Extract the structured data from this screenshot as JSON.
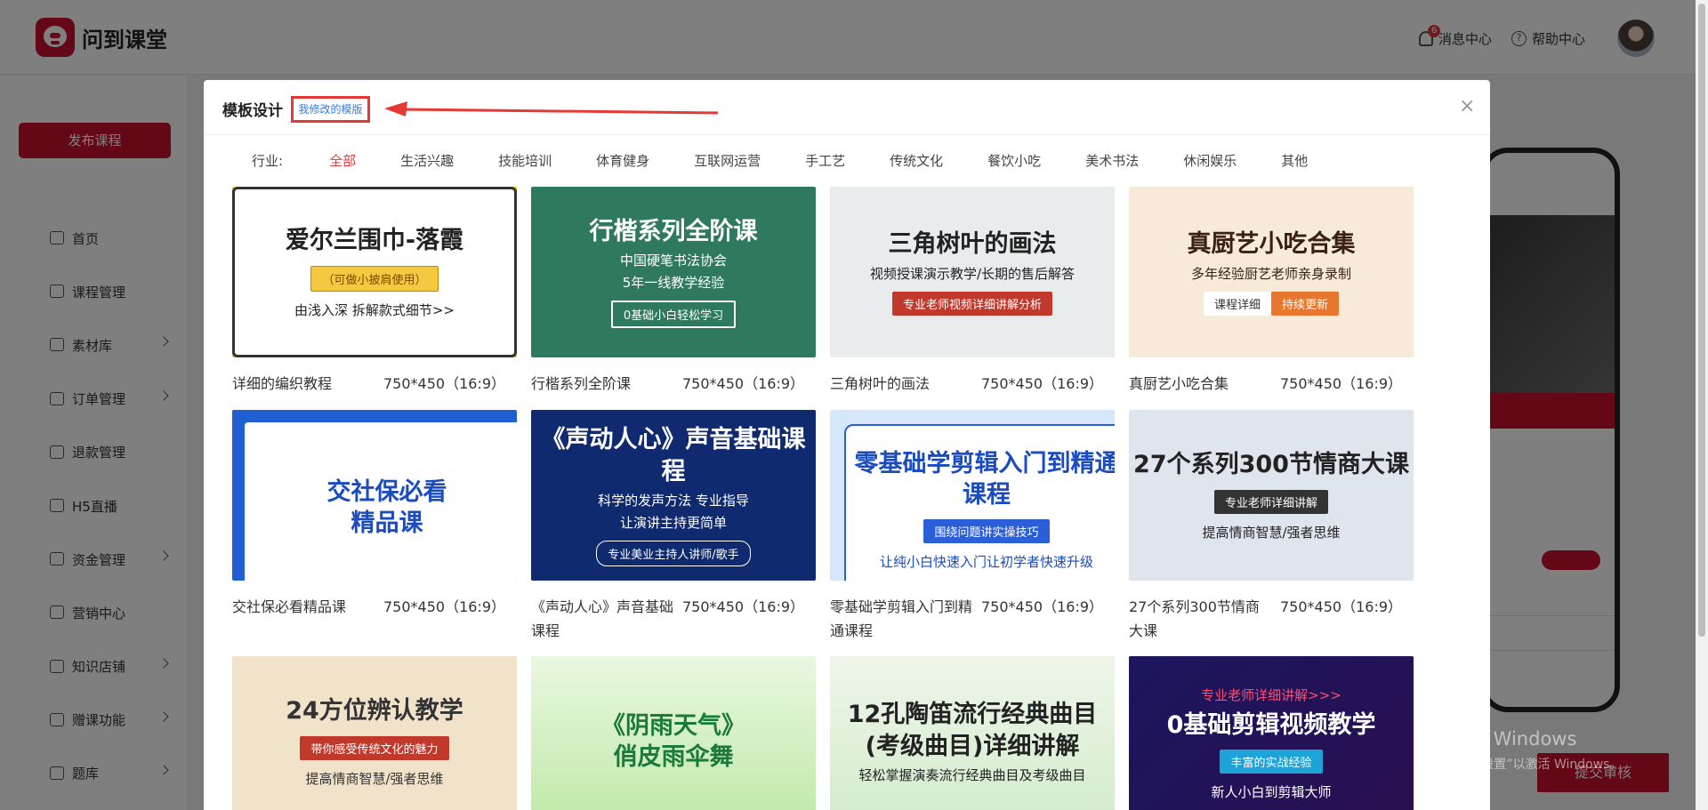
{
  "app": {
    "logo_text": "问到课堂"
  },
  "header": {
    "messages_label": "消息中心",
    "messages_count": "6",
    "help_label": "帮助中心",
    "help_icon_glyph": "?"
  },
  "sidebar": {
    "publish_label": "发布课程",
    "items": [
      {
        "label": "首页",
        "has_arrow": false
      },
      {
        "label": "课程管理",
        "has_arrow": false
      },
      {
        "label": "素材库",
        "has_arrow": true
      },
      {
        "label": "订单管理",
        "has_arrow": true
      },
      {
        "label": "退款管理",
        "has_arrow": false
      },
      {
        "label": "H5直播",
        "has_arrow": false
      },
      {
        "label": "资金管理",
        "has_arrow": true
      },
      {
        "label": "营销中心",
        "has_arrow": false
      },
      {
        "label": "知识店铺",
        "has_arrow": true
      },
      {
        "label": "赠课功能",
        "has_arrow": true
      },
      {
        "label": "题库",
        "has_arrow": true
      }
    ]
  },
  "background": {
    "submit_label": "提交审核"
  },
  "watermark": {
    "line1": "激活 Windows",
    "line2": "转到“设置”以激活 Windows。"
  },
  "modal": {
    "title": "模板设计",
    "my_templates_label": "我修改的模版",
    "close_glyph": "×",
    "filter_label": "行业:",
    "filters": [
      "全部",
      "生活兴趣",
      "技能培训",
      "体育健身",
      "互联网运营",
      "手工艺",
      "传统文化",
      "餐饮小吃",
      "美术书法",
      "休闲娱乐",
      "其他"
    ],
    "active_filter": "全部",
    "templates": [
      {
        "name": "详细的编织教程",
        "size": "750*450（16:9）",
        "thumb_title": "爱尔兰围巾-落霞",
        "thumb_sub": "由浅入深 拆解款式细节>>",
        "thumb_tag": "（可做小披肩使用）"
      },
      {
        "name": "行楷系列全阶课",
        "size": "750*450（16:9）",
        "thumb_title": "行楷系列全阶课",
        "thumb_sub": "中国硬笔书法协会",
        "thumb_sub2": "5年一线教学经验",
        "thumb_tag": "0基础小白轻松学习"
      },
      {
        "name": "三角树叶的画法",
        "size": "750*450（16:9）",
        "thumb_title": "三角树叶的画法",
        "thumb_sub": "视频授课演示教学/长期的售后解答",
        "thumb_tag": "专业老师视频详细讲解分析"
      },
      {
        "name": "真厨艺小吃合集",
        "size": "750*450（16:9）",
        "thumb_title": "真厨艺小吃合集",
        "thumb_sub": "多年经验厨艺老师亲身录制",
        "thumb_tag": "课程详细",
        "thumb_tag2": "持续更新"
      },
      {
        "name": "交社保必看精品课",
        "size": "750*450（16:9）",
        "thumb_title": "交社保必看",
        "thumb_title2": "精品课"
      },
      {
        "name": "《声动人心》声音基础课程",
        "size": "750*450（16:9）",
        "thumb_title": "《声动人心》声音基础课程",
        "thumb_sub": "科学的发声方法 专业指导",
        "thumb_sub2": "让演讲主持更简单",
        "thumb_tag": "专业美业主持人讲师/歌手"
      },
      {
        "name": "零基础学剪辑入门到精通课程",
        "size": "750*450（16:9）",
        "thumb_title": "零基础学剪辑入门到精通课程",
        "thumb_tag": "围绕问题讲实操技巧",
        "thumb_sub": "让纯小白快速入门让初学者快速升级"
      },
      {
        "name": "27个系列300节情商大课",
        "size": "750*450（16:9）",
        "thumb_title": "27个系列300节情商大课",
        "thumb_tag": "专业老师详细讲解",
        "thumb_sub": "提高情商智慧/强者思维"
      },
      {
        "name": "",
        "size": "",
        "thumb_title": "24方位辨认教学",
        "thumb_tag": "带你感受传统文化的魅力",
        "thumb_sub": "提高情商智慧/强者思维"
      },
      {
        "name": "",
        "size": "",
        "thumb_title": "《阴雨天气》",
        "thumb_title2": "俏皮雨伞舞"
      },
      {
        "name": "",
        "size": "",
        "thumb_title": "12孔陶笛流行经典曲目",
        "thumb_title2": "(考级曲目)详细讲解",
        "thumb_sub": "轻松掌握演奏流行经典曲目及考级曲目"
      },
      {
        "name": "",
        "size": "",
        "thumb_sub0": "专业老师详细讲解>>>",
        "thumb_title": "0基础剪辑视频教学",
        "thumb_tag": "丰富的实战经验",
        "thumb_sub": "新人小白到剪辑大师"
      }
    ]
  },
  "colors": {
    "brand": "#c8102e",
    "active": "#e53935",
    "link": "#2f7be5"
  }
}
